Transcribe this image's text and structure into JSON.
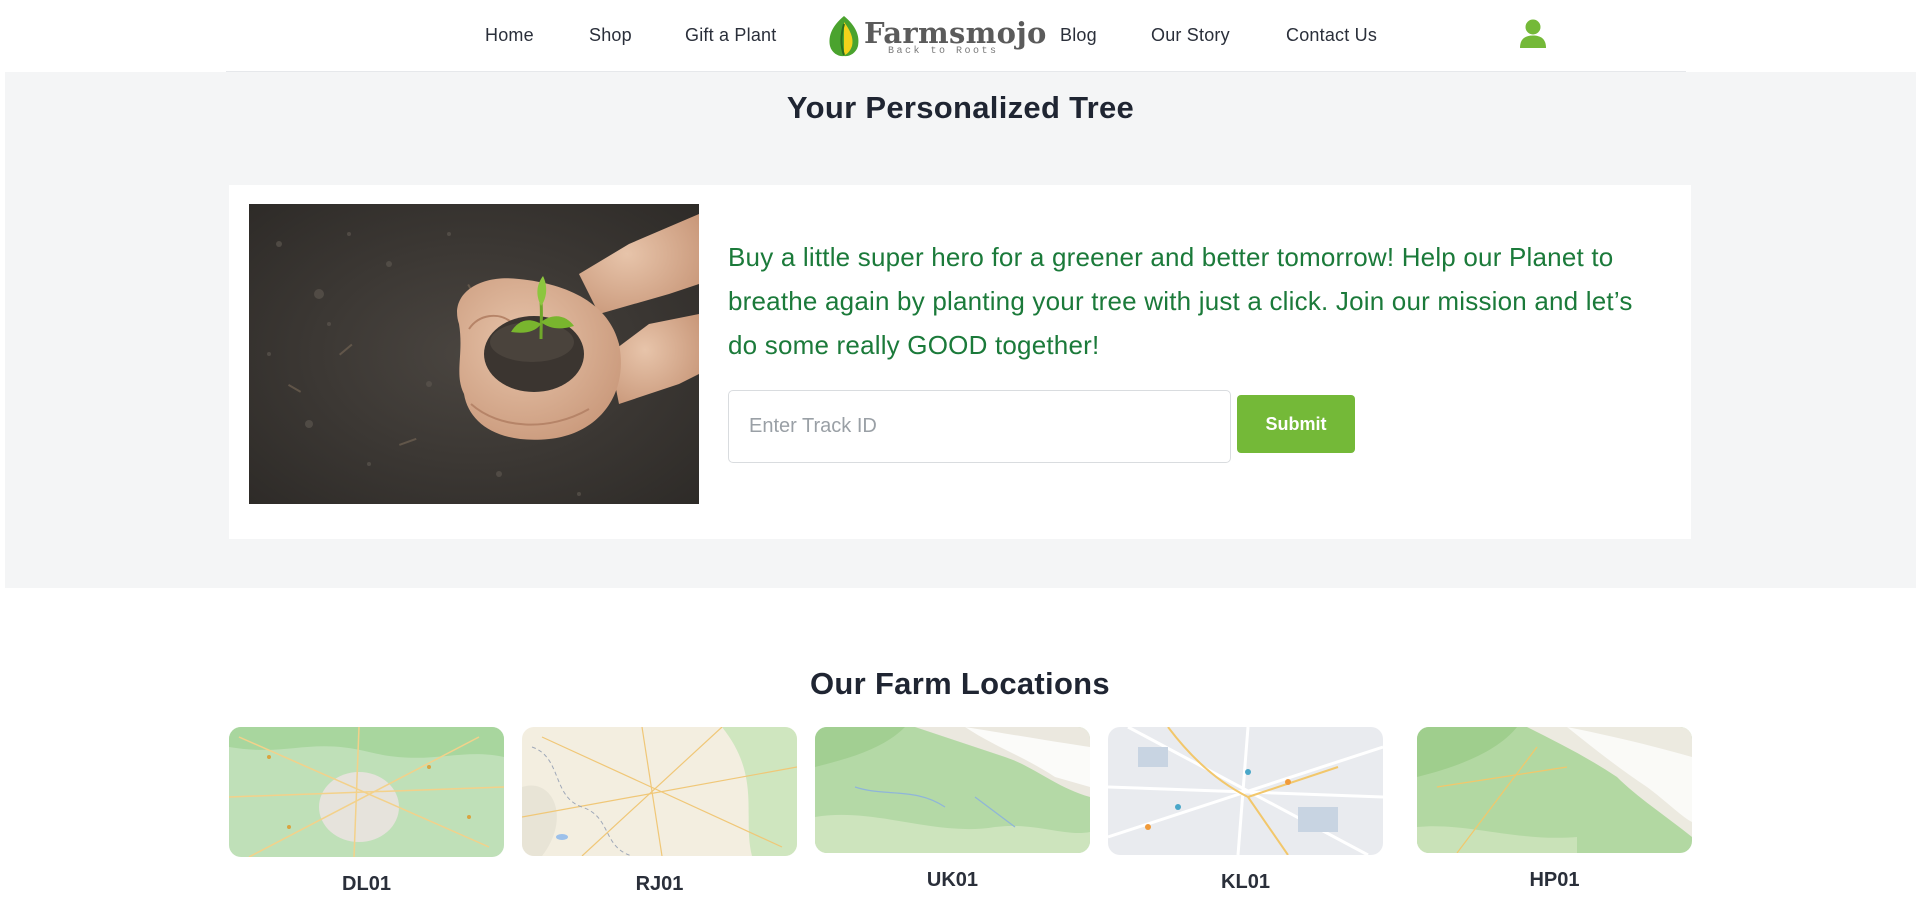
{
  "nav": {
    "items": [
      {
        "label": "Home"
      },
      {
        "label": "Shop"
      },
      {
        "label": "Gift a Plant"
      },
      {
        "label": "Blog"
      },
      {
        "label": "Our Story"
      },
      {
        "label": "Contact Us"
      }
    ],
    "logo": {
      "name": "Farmsmojo",
      "tagline": "Back to Roots"
    },
    "user_icon": "user-icon"
  },
  "hero": {
    "title": "Your Personalized Tree",
    "description": "Buy a little super hero for a greener and better tomorrow! Help our Planet to breathe again by planting your tree with just a click. Join our mission and let’s do some really GOOD together!",
    "track_placeholder": "Enter Track ID",
    "track_value": "",
    "submit_label": "Submit"
  },
  "farms": {
    "title": "Our Farm Locations",
    "locations": [
      {
        "code": "DL01"
      },
      {
        "code": "RJ01"
      },
      {
        "code": "UK01"
      },
      {
        "code": "KL01"
      },
      {
        "code": "HP01"
      }
    ]
  },
  "colors": {
    "accent": "#74b938",
    "hero_text": "#1b7a3a",
    "heading": "#1f2532",
    "hero_bg": "#f4f5f6"
  }
}
